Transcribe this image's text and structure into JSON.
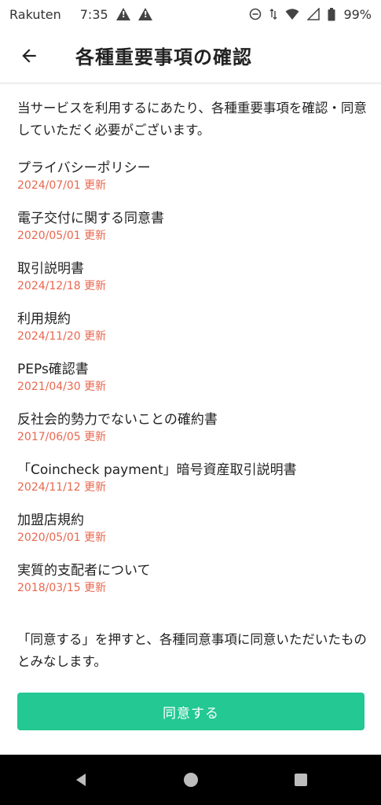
{
  "status_bar": {
    "carrier": "Rakuten",
    "time": "7:35",
    "battery": "99%"
  },
  "header": {
    "title": "各種重要事項の確認"
  },
  "intro_text": "当サービスを利用するにあたり、各種重要事項を確認・同意していただく必要がございます。",
  "documents": [
    {
      "title": "プライバシーポリシー",
      "date": "2024/07/01 更新"
    },
    {
      "title": "電子交付に関する同意書",
      "date": "2020/05/01 更新"
    },
    {
      "title": "取引説明書",
      "date": "2024/12/18 更新"
    },
    {
      "title": "利用規約",
      "date": "2024/11/20 更新"
    },
    {
      "title": "PEPs確認書",
      "date": "2021/04/30 更新"
    },
    {
      "title": "反社会的勢力でないことの確約書",
      "date": "2017/06/05 更新"
    },
    {
      "title": "「Coincheck payment」暗号資産取引説明書",
      "date": "2024/11/12 更新"
    },
    {
      "title": "加盟店規約",
      "date": "2020/05/01 更新"
    },
    {
      "title": "実質的支配者について",
      "date": "2018/03/15 更新"
    }
  ],
  "note_text": "「同意する」を押すと、各種同意事項に同意いただいたものとみなします。",
  "agree_button_label": "同意する",
  "colors": {
    "accent": "#23c893",
    "date_text": "#e8674f"
  },
  "icons": {
    "back": "arrow-left-icon",
    "nav_back": "triangle-back-icon",
    "nav_home": "circle-home-icon",
    "nav_recents": "square-recents-icon"
  }
}
